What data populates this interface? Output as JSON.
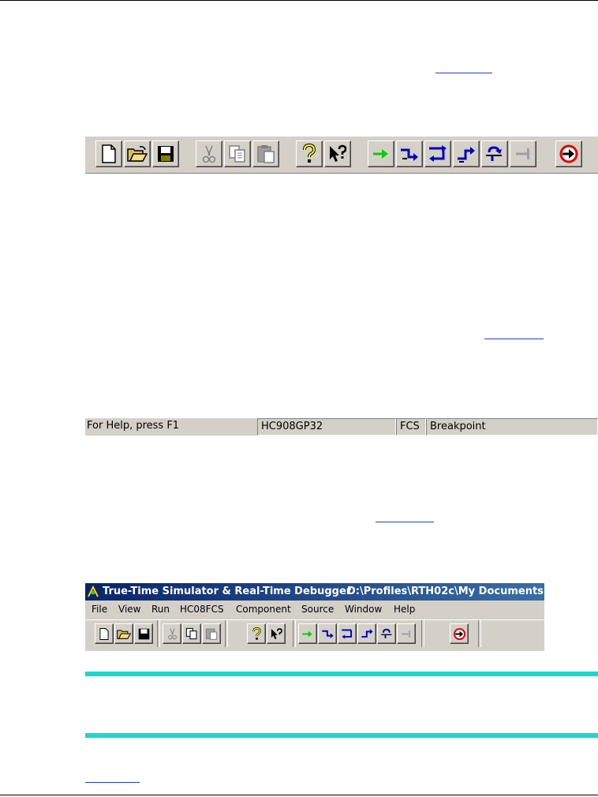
{
  "status_bar": {
    "help_text": "For Help, press F1",
    "target": "HC908GP32",
    "connection": "FCS",
    "state": "Breakpoint"
  },
  "app_window": {
    "title_app": "True-Time Simulator & Real-Time Debugger",
    "title_path": "D:\\Profiles\\RTH02c\\My Documents",
    "menu": [
      "File",
      "View",
      "Run",
      "HC08FCS",
      "Component",
      "Source",
      "Window",
      "Help"
    ]
  },
  "toolbar_icons": [
    "new-file-icon",
    "open-folder-icon",
    "save-icon",
    "cut-icon",
    "copy-icon",
    "paste-icon",
    "help-icon",
    "context-help-icon",
    "start-continue-icon",
    "single-step-icon",
    "step-over-icon",
    "step-out-icon",
    "assembly-step-icon",
    "halt-icon",
    "reset-target-icon"
  ],
  "colors": {
    "link": "#1a3fd8",
    "callout_rule": "#1dd6cf",
    "title_bar_start": "#0a246a",
    "title_bar_end": "#3a6ea5",
    "face": "#d4d0c8"
  }
}
